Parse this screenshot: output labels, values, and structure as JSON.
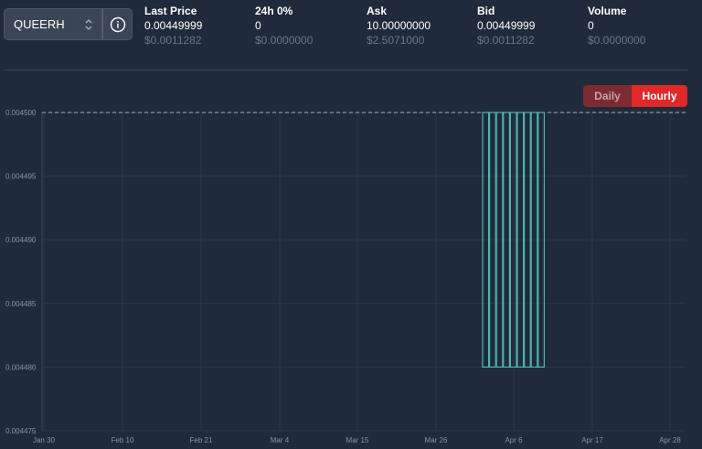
{
  "pair_selector": {
    "value": "QUEERH"
  },
  "stats": [
    {
      "label": "Last Price",
      "value": "0.00449999",
      "usd": "$0.0011282"
    },
    {
      "label": "24h 0%",
      "value": "0",
      "usd": "$0.0000000"
    },
    {
      "label": "Ask",
      "value": "10.00000000",
      "usd": "$2.5071000"
    },
    {
      "label": "Bid",
      "value": "0.00449999",
      "usd": "$0.0011282"
    },
    {
      "label": "Volume",
      "value": "0",
      "usd": "$0.0000000"
    }
  ],
  "toggle": {
    "daily_label": "Daily",
    "hourly_label": "Hourly",
    "active": "Hourly"
  },
  "colors": {
    "accent": "#e02828",
    "bar": "#4fb3b3",
    "background": "#1f2a3a"
  },
  "chart_data": {
    "type": "bar",
    "y_ticks": [
      "0.004475",
      "0.004480",
      "0.004485",
      "0.004490",
      "0.004495",
      "0.004500"
    ],
    "x_ticks": [
      "Jan 30",
      "Feb 10",
      "Feb 21",
      "Mar 4",
      "Mar 15",
      "Mar 26",
      "Apr 6",
      "Apr 17",
      "Apr 28"
    ],
    "ylim": [
      0.004475,
      0.0045
    ],
    "reference_line": 0.0045,
    "series": [
      {
        "low": 0.00448,
        "high": 0.0045,
        "count": 9
      }
    ],
    "grid": true
  }
}
